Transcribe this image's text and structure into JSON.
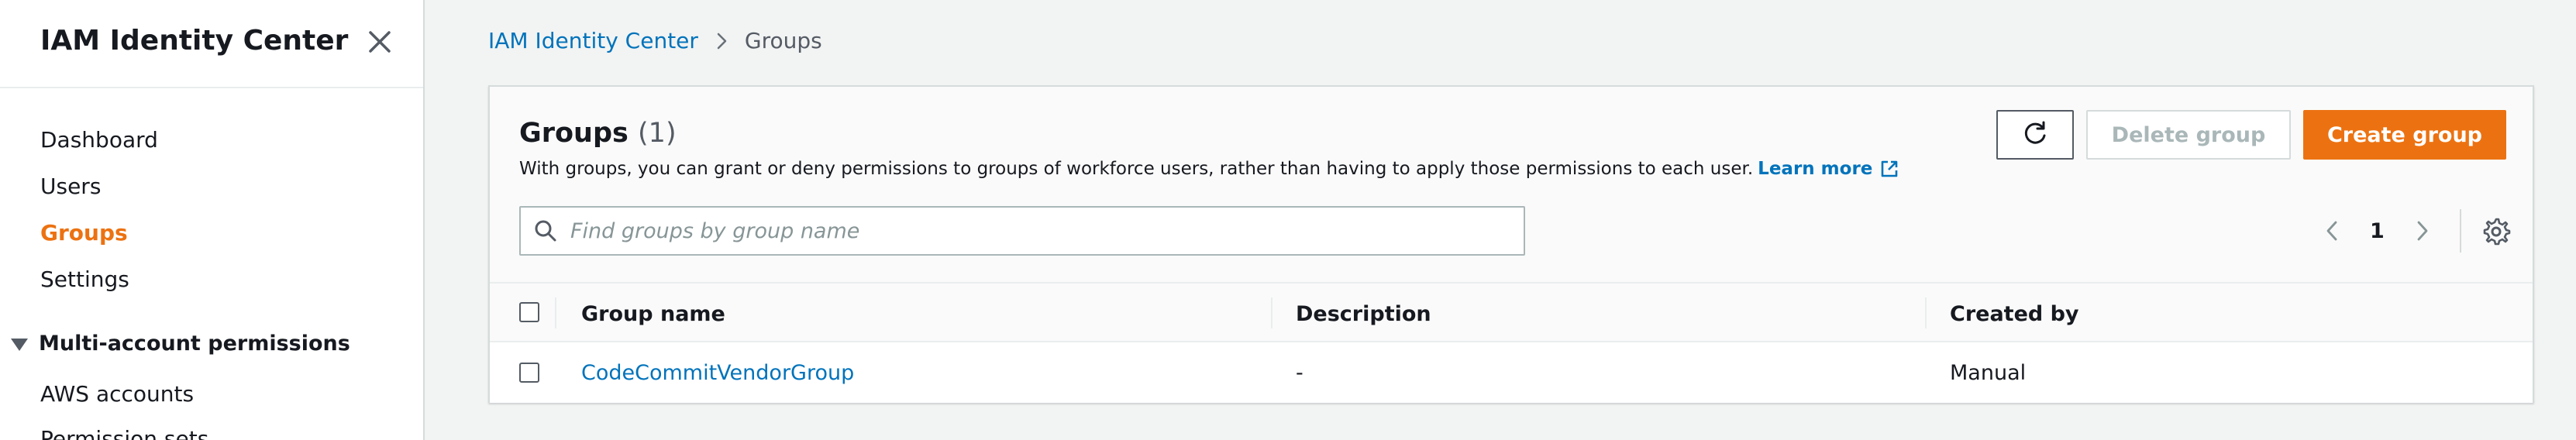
{
  "sidebar": {
    "title": "IAM Identity Center",
    "items": [
      {
        "label": "Dashboard"
      },
      {
        "label": "Users"
      },
      {
        "label": "Groups"
      },
      {
        "label": "Settings"
      }
    ],
    "section": {
      "label": "Multi-account permissions",
      "items": [
        {
          "label": "AWS accounts"
        },
        {
          "label": "Permission sets"
        }
      ]
    }
  },
  "breadcrumb": {
    "root": "IAM Identity Center",
    "current": "Groups"
  },
  "panel": {
    "title": "Groups",
    "count": "(1)",
    "description": "With groups, you can grant or deny permissions to groups of workforce users, rather than having to apply those permissions to each user.",
    "learn_more": "Learn more",
    "delete_label": "Delete group",
    "create_label": "Create group",
    "search_placeholder": "Find groups by group name",
    "page_number": "1"
  },
  "table": {
    "columns": [
      "Group name",
      "Description",
      "Created by"
    ],
    "rows": [
      {
        "name": "CodeCommitVendorGroup",
        "description": "-",
        "created_by": "Manual"
      }
    ]
  },
  "colors": {
    "accent": "#ec7211",
    "link": "#0073bb"
  }
}
